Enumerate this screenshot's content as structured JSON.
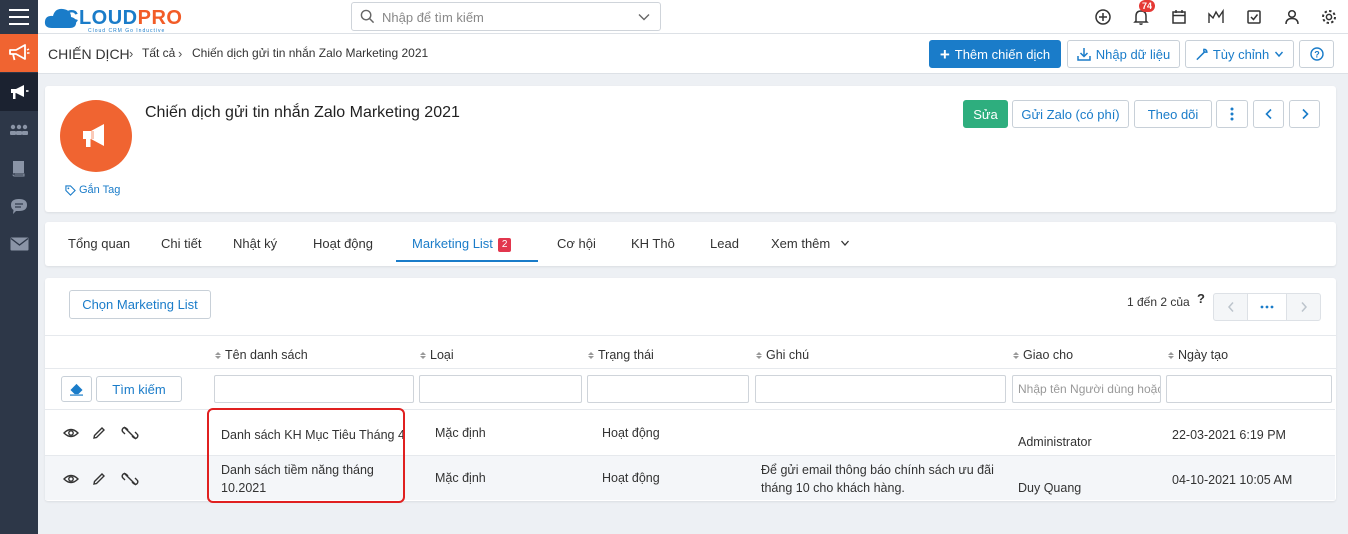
{
  "app": {
    "logo_primary": "CLOUD",
    "logo_accent": "PRO",
    "logo_tagline": "Cloud CRM Go Inductive",
    "brand_color": "#1a7cc9",
    "accent_color": "#f06431"
  },
  "search": {
    "placeholder": "Nhập để tìm kiếm"
  },
  "notifications": {
    "count": "74"
  },
  "module": {
    "title": "CHIẾN DỊCH"
  },
  "breadcrumb": {
    "all": "Tất cả",
    "current": "Chiến dịch gửi tin nhắn Zalo Marketing 2021"
  },
  "toolbar": {
    "add_label": "Thêm chiến dịch",
    "import_label": "Nhập dữ liệu",
    "customize_label": "Tùy chỉnh"
  },
  "record": {
    "title": "Chiến dịch gửi tin nhắn Zalo Marketing 2021",
    "tag_label": "Gắn Tag",
    "edit_label": "Sửa",
    "zalo_label": "Gửi Zalo (có phí)",
    "follow_label": "Theo dõi"
  },
  "tabs": [
    {
      "label": "Tổng quan"
    },
    {
      "label": "Chi tiết"
    },
    {
      "label": "Nhật ký"
    },
    {
      "label": "Hoạt động"
    },
    {
      "label": "Marketing List",
      "badge": "2"
    },
    {
      "label": "Cơ hội"
    },
    {
      "label": "KH Thô"
    },
    {
      "label": "Lead"
    },
    {
      "label": "Xem thêm"
    }
  ],
  "list": {
    "choose_label": "Chọn Marketing List",
    "pagination": "1 đến 2 của",
    "help": "?",
    "search_label": "Tìm kiếm",
    "assignee_placeholder": "Nhập tên Người dùng hoặc",
    "columns": [
      "Tên danh sách",
      "Loại",
      "Trạng thái",
      "Ghi chú",
      "Giao cho",
      "Ngày tạo"
    ],
    "rows": [
      {
        "name": "Danh sách KH Mục Tiêu Tháng 4",
        "type": "Mặc định",
        "status": "Hoạt động",
        "note": "",
        "assignee": "Administrator",
        "created": "22-03-2021 6:19 PM"
      },
      {
        "name": "Danh sách tiềm năng tháng 10.2021",
        "type": "Mặc định",
        "status": "Hoạt động",
        "note": "Để gửi email thông báo chính sách ưu đãi tháng 10 cho khách hàng.",
        "assignee": "Duy Quang",
        "created": "04-10-2021 10:05 AM"
      }
    ]
  }
}
